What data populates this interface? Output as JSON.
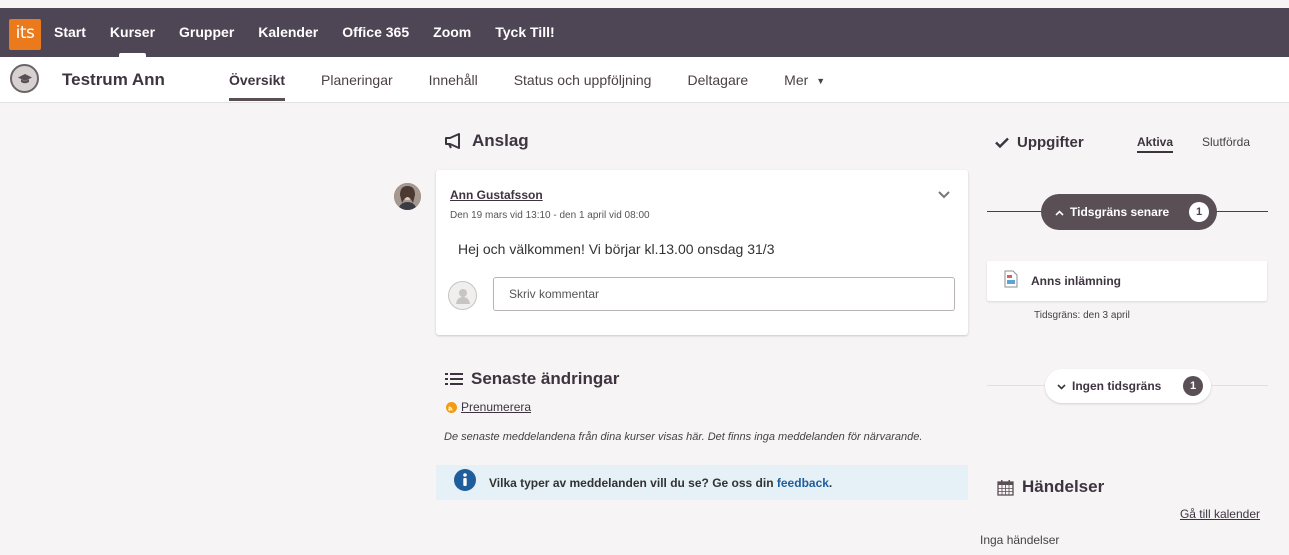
{
  "logo": {
    "text": "its"
  },
  "topnav": [
    "Start",
    "Kurser",
    "Grupper",
    "Kalender",
    "Office 365",
    "Zoom",
    "Tyck Till!"
  ],
  "course": {
    "title": "Testrum Ann",
    "tabs": [
      "Översikt",
      "Planeringar",
      "Innehåll",
      "Status och uppföljning",
      "Deltagare",
      "Mer"
    ]
  },
  "announcements": {
    "heading": "Anslag",
    "post": {
      "author": "Ann Gustafsson",
      "dates": "Den 19 mars vid 13:10 - den 1 april vid 08:00",
      "body": "Hej och välkommen! Vi börjar kl.13.00 onsdag 31/3",
      "comment_placeholder": "Skriv kommentar"
    }
  },
  "recent": {
    "heading": "Senaste ändringar",
    "subscribe": "Prenumerera",
    "description": "De senaste meddelandena från dina kurser visas här. Det finns inga meddelanden för närvarande.",
    "info_text": "Vilka typer av meddelanden vill du se? Ge oss din",
    "info_link": "feedback",
    "info_end": "."
  },
  "tasks": {
    "heading": "Uppgifter",
    "tab_active": "Aktiva",
    "tab_done": "Slutförda",
    "later": {
      "label": "Tidsgräns senare",
      "count": "1"
    },
    "task": {
      "title": "Anns inlämning",
      "deadline": "Tidsgräns: den 3 april"
    },
    "none": {
      "label": "Ingen tidsgräns",
      "count": "1"
    }
  },
  "events": {
    "heading": "Händelser",
    "calendar_link": "Gå till kalender",
    "empty": "Inga händelser"
  }
}
